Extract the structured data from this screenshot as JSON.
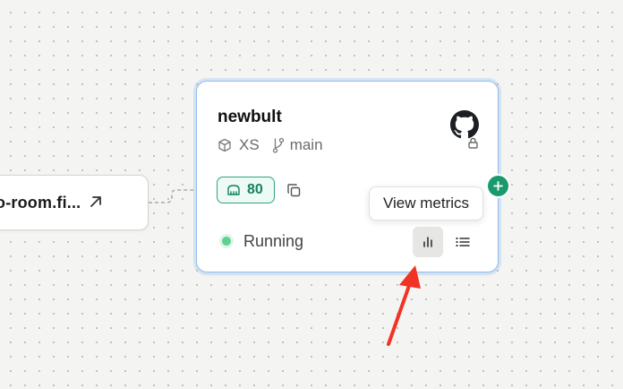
{
  "canvas": {
    "background": "#f4f4f3",
    "dot_color": "#b9b9b6"
  },
  "domain_node": {
    "label": "o-room.fi...",
    "icon": "arrow-up-right-icon"
  },
  "service": {
    "name": "newbult",
    "size": "XS",
    "branch": "main",
    "repo_icon": "github-icon",
    "repo_locked": true,
    "port": "80",
    "status": "Running",
    "status_color": "#5fd08f",
    "accent": "#1a9a6c",
    "border_color": "#8fbdf1"
  },
  "tooltip": {
    "text": "View metrics"
  },
  "actions": {
    "metrics_icon": "bar-chart-icon",
    "logs_icon": "list-icon",
    "add_icon": "plus-icon",
    "copy_icon": "copy-icon"
  },
  "annotation": {
    "arrow_color": "#f03324",
    "icon": "red-arrow-icon"
  }
}
